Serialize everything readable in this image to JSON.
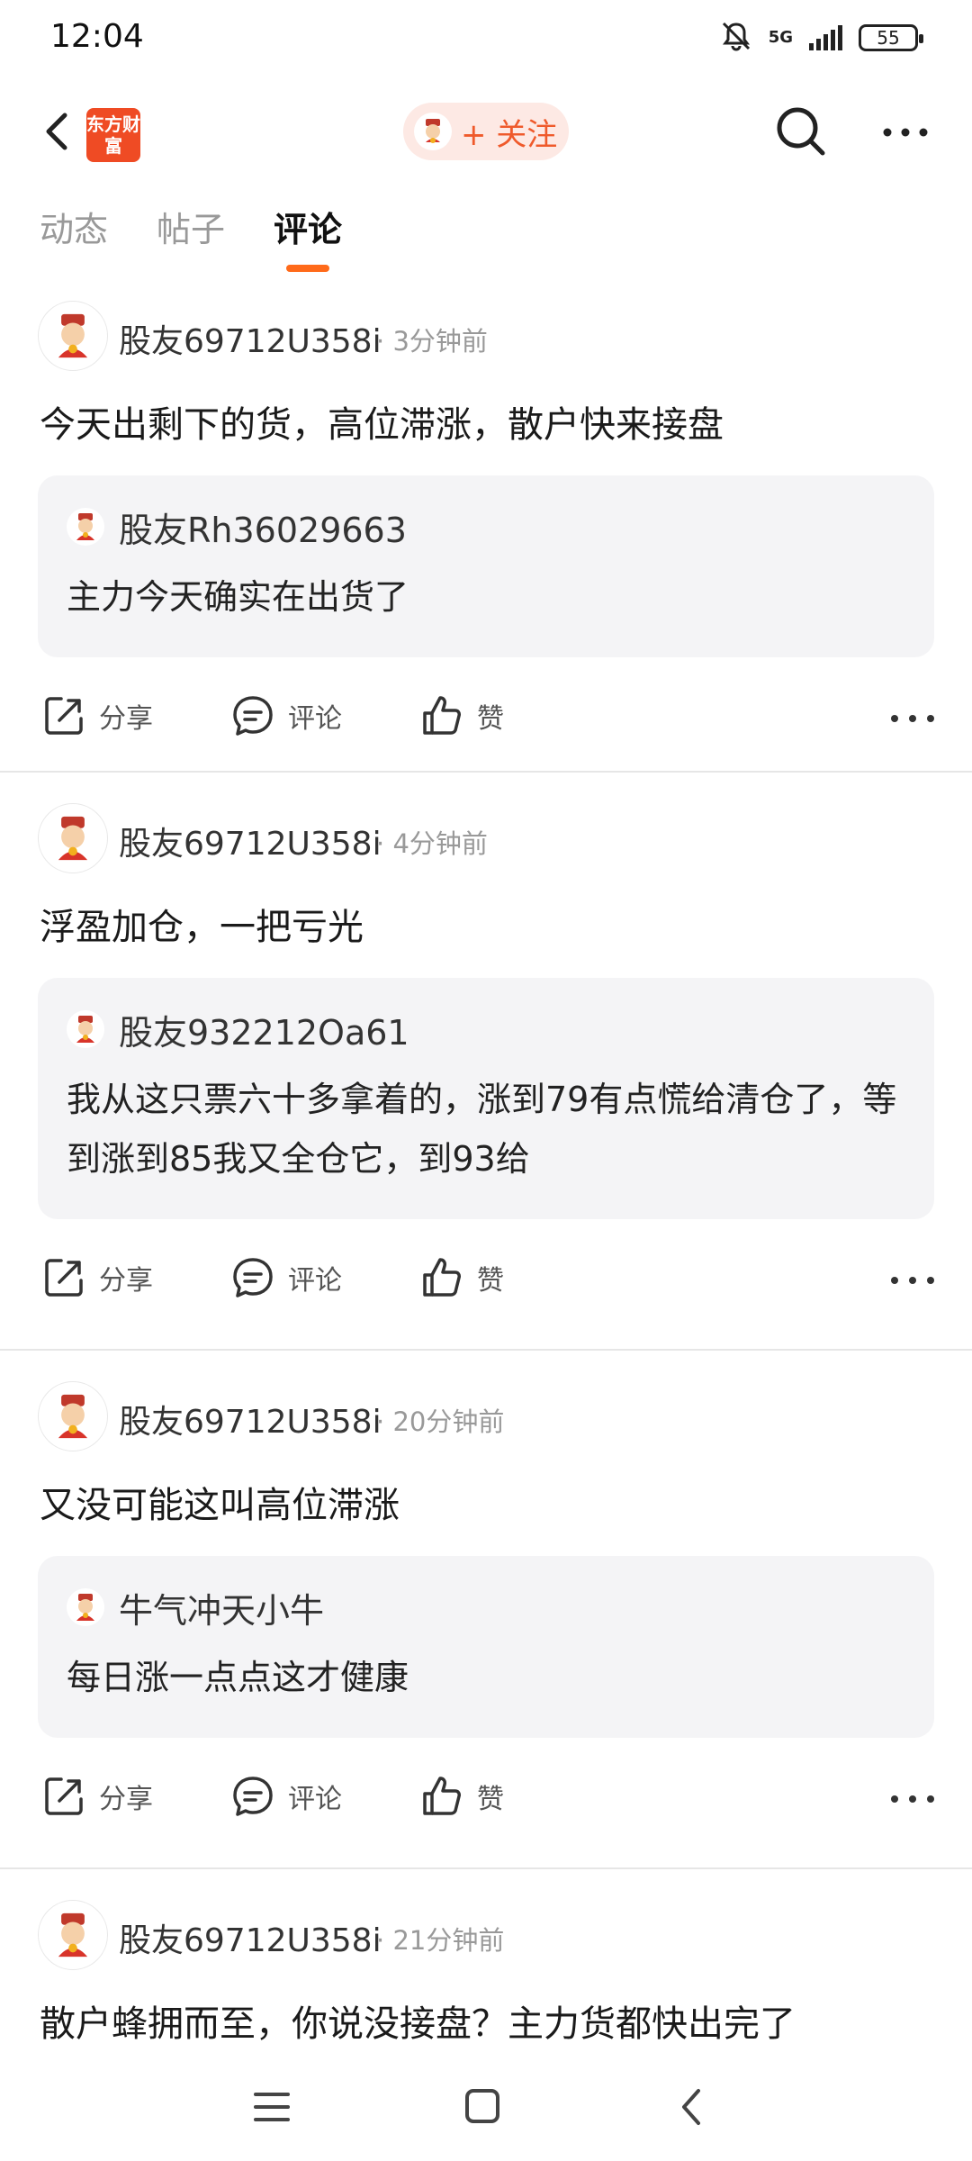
{
  "status_bar": {
    "time": "12:04",
    "network": "5G",
    "battery": "55"
  },
  "top_nav": {
    "logo_text": "东方财富",
    "follow_label": "+ 关注"
  },
  "tabs": [
    {
      "label": "动态"
    },
    {
      "label": "帖子"
    },
    {
      "label": "评论"
    }
  ],
  "posts": [
    {
      "user": "股友69712U358i",
      "time": "3分钟前",
      "text": "今天出剩下的货，高位滞涨，散户快来接盘",
      "quote": {
        "user": "股友Rh36029663",
        "text": "主力今天确实在出货了"
      }
    },
    {
      "user": "股友69712U358i",
      "time": "4分钟前",
      "text": "浮盈加仓，一把亏光",
      "quote": {
        "user": "股友932212Oa61",
        "text": "我从这只票六十多拿着的，涨到79有点慌给清仓了，等到涨到85我又全仓它，到93给"
      }
    },
    {
      "user": "股友69712U358i",
      "time": "20分钟前",
      "text": "又没可能这叫高位滞涨",
      "quote": {
        "user": "牛气冲天小牛",
        "text": "每日涨一点点这才健康"
      }
    },
    {
      "user": "股友69712U358i",
      "time": "21分钟前",
      "text": "散户蜂拥而至，你说没接盘？主力货都快出完了"
    }
  ],
  "actions": {
    "share": "分享",
    "comment": "评论",
    "like": "赞"
  },
  "colors": {
    "accent": "#ff6a1a",
    "brand": "#ef4b24",
    "quote_bg": "#f4f4f6"
  }
}
